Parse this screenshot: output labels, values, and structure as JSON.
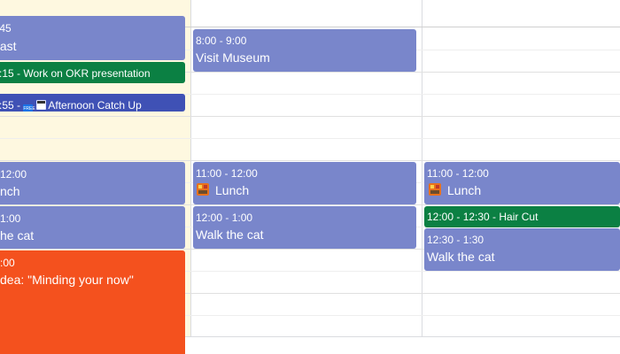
{
  "columns": {
    "today_bg": "#fef8e0",
    "grid_line": "#dadce0"
  },
  "events": {
    "breakfast": {
      "time": ":45",
      "title": "fast",
      "color": "#7986cb"
    },
    "okr": {
      "label": ":15 - Work on OKR presentation",
      "color": "#0b8043"
    },
    "afternoon_catch_up": {
      "time": ":55 -",
      "free_icon": "free-icon",
      "cal_icon": "calendar-icon",
      "title": "Afternoon Catch Up",
      "color": "#3f51b5"
    },
    "visit_museum": {
      "time": "8:00 - 9:00",
      "title": "Visit Museum",
      "color": "#7986cb"
    },
    "lunch_col1": {
      "time": "12:00",
      "title": "nch",
      "color": "#7986cb"
    },
    "walk_cat_col1": {
      "time": "1:00",
      "title": "he cat",
      "color": "#7986cb"
    },
    "idea": {
      "time": ":00",
      "title": "dea: \"Minding your now\"",
      "color": "#f4511e"
    },
    "lunch_col2": {
      "time": "11:00 - 12:00",
      "icon": "lunch-icon",
      "title": "Lunch",
      "color": "#7986cb"
    },
    "walk_cat_col2": {
      "time": "12:00 - 1:00",
      "title": "Walk the cat",
      "color": "#7986cb"
    },
    "lunch_col3": {
      "time": "11:00 - 12:00",
      "icon": "lunch-icon",
      "title": "Lunch",
      "color": "#7986cb"
    },
    "hair_cut": {
      "label": "12:00 - 12:30 - Hair Cut",
      "color": "#0b8043"
    },
    "walk_cat_col3": {
      "time": "12:30 - 1:30",
      "title": "Walk the cat",
      "color": "#7986cb"
    }
  }
}
